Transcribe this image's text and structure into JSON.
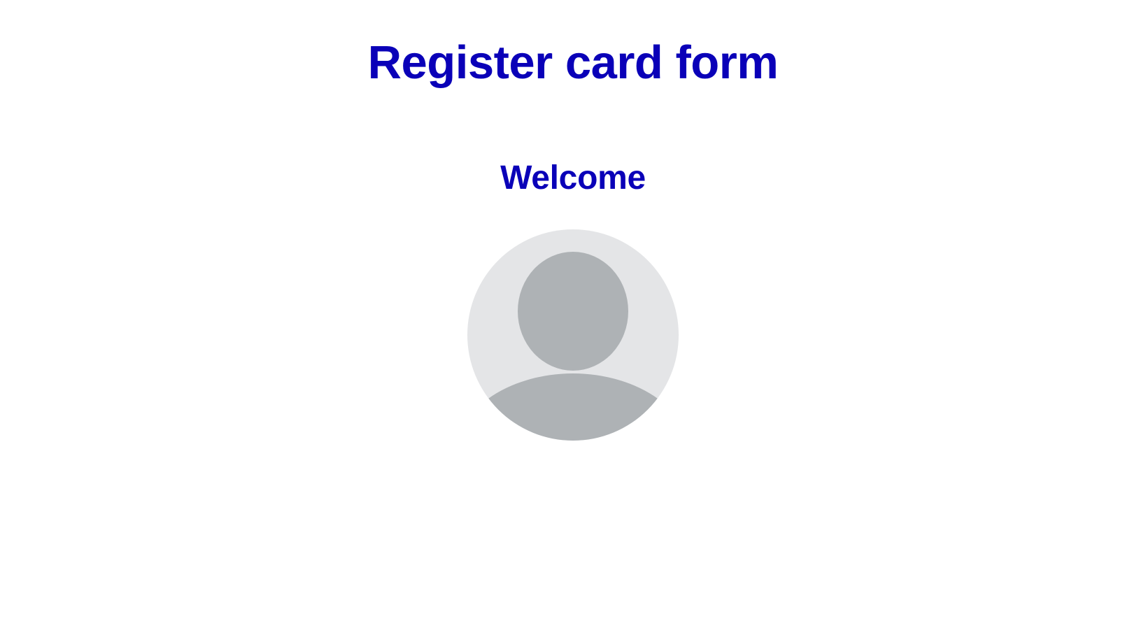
{
  "header": {
    "title": "Register card form"
  },
  "main": {
    "welcome_heading": "Welcome",
    "avatar": {
      "icon": "user-avatar-placeholder-icon"
    }
  },
  "colors": {
    "heading": "#0a00b8",
    "avatar_background": "#e4e5e7",
    "avatar_silhouette": "#aeb2b5",
    "page_background": "#ffffff"
  }
}
